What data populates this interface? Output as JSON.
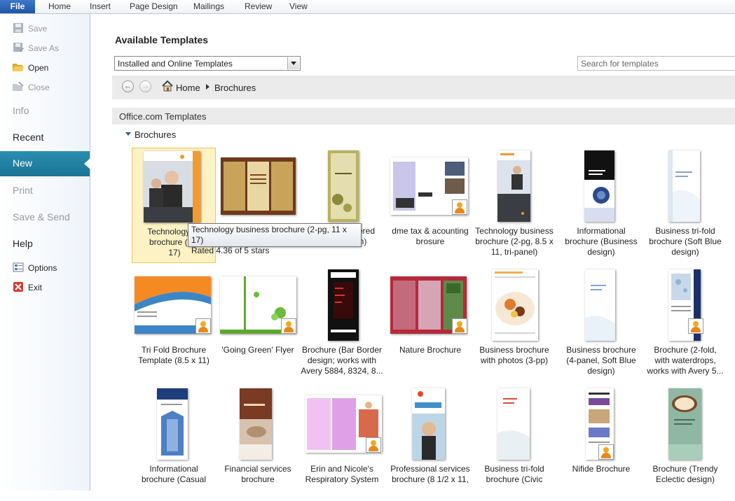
{
  "ribbon": {
    "file": "File",
    "tabs": [
      "Home",
      "Insert",
      "Page Design",
      "Mailings",
      "Review",
      "View"
    ]
  },
  "nav": {
    "save": "Save",
    "save_as": "Save As",
    "open": "Open",
    "close": "Close",
    "info": "Info",
    "recent": "Recent",
    "new": "New",
    "print": "Print",
    "save_send": "Save & Send",
    "help": "Help",
    "options": "Options",
    "exit": "Exit"
  },
  "main": {
    "title": "Available Templates",
    "source_select": "Installed and Online Templates",
    "search_placeholder": "Search for templates",
    "breadcrumb": [
      "Home",
      "Brochures"
    ],
    "section": "Office.com Templates",
    "group": "Brochures"
  },
  "tooltip": {
    "line1": "Technology business brochure (2-pg, 11 x 17)",
    "line2": "Rated 4.36 of 5 stars"
  },
  "templates": [
    {
      "lines": [
        "Technology bu",
        "brochure (2-p",
        "17)"
      ]
    },
    {
      "lines": [
        "",
        ""
      ]
    },
    {
      "lines": [
        "thered",
        "n)"
      ]
    },
    {
      "lines": [
        "dme tax & acounting",
        "brosure"
      ]
    },
    {
      "lines": [
        "Technology business",
        "brochure (2-pg, 8.5 x",
        "11, tri-panel)"
      ]
    },
    {
      "lines": [
        "Informational",
        "brochure (Business",
        "design)"
      ]
    },
    {
      "lines": [
        "Business tri-fold",
        "brochure (Soft Blue",
        "design)"
      ]
    },
    {
      "lines": [
        "Tri Fold Brochure",
        "Template (8.5 x 11)"
      ]
    },
    {
      "lines": [
        "'Going Green' Flyer"
      ]
    },
    {
      "lines": [
        "Brochure (Bar Border",
        "design; works with",
        "Avery 5884, 8324, 8..."
      ]
    },
    {
      "lines": [
        "Nature Brochure"
      ]
    },
    {
      "lines": [
        "Business brochure",
        "with photos (3-pp)"
      ]
    },
    {
      "lines": [
        "Business brochure",
        "(4-panel, Soft Blue",
        "design)"
      ]
    },
    {
      "lines": [
        "Brochure (2-fold,",
        "with waterdrops,",
        "works with Avery 5..."
      ]
    },
    {
      "lines": [
        "Informational",
        "brochure (Casual"
      ]
    },
    {
      "lines": [
        "Financial services",
        "brochure"
      ]
    },
    {
      "lines": [
        "Erin and Nicole's",
        "Respiratory System"
      ]
    },
    {
      "lines": [
        "Professional services",
        "brochure (8 1/2 x 11,"
      ]
    },
    {
      "lines": [
        "Business tri-fold",
        "brochure (Civic"
      ]
    },
    {
      "lines": [
        "Nifide Brochure"
      ]
    },
    {
      "lines": [
        "Brochure (Trendy",
        "Eclectic design)"
      ]
    }
  ],
  "colors": {
    "accent": "#1b7f9e",
    "file_tab": "#2a62b5",
    "selected_tile": "#fdf2c4"
  }
}
